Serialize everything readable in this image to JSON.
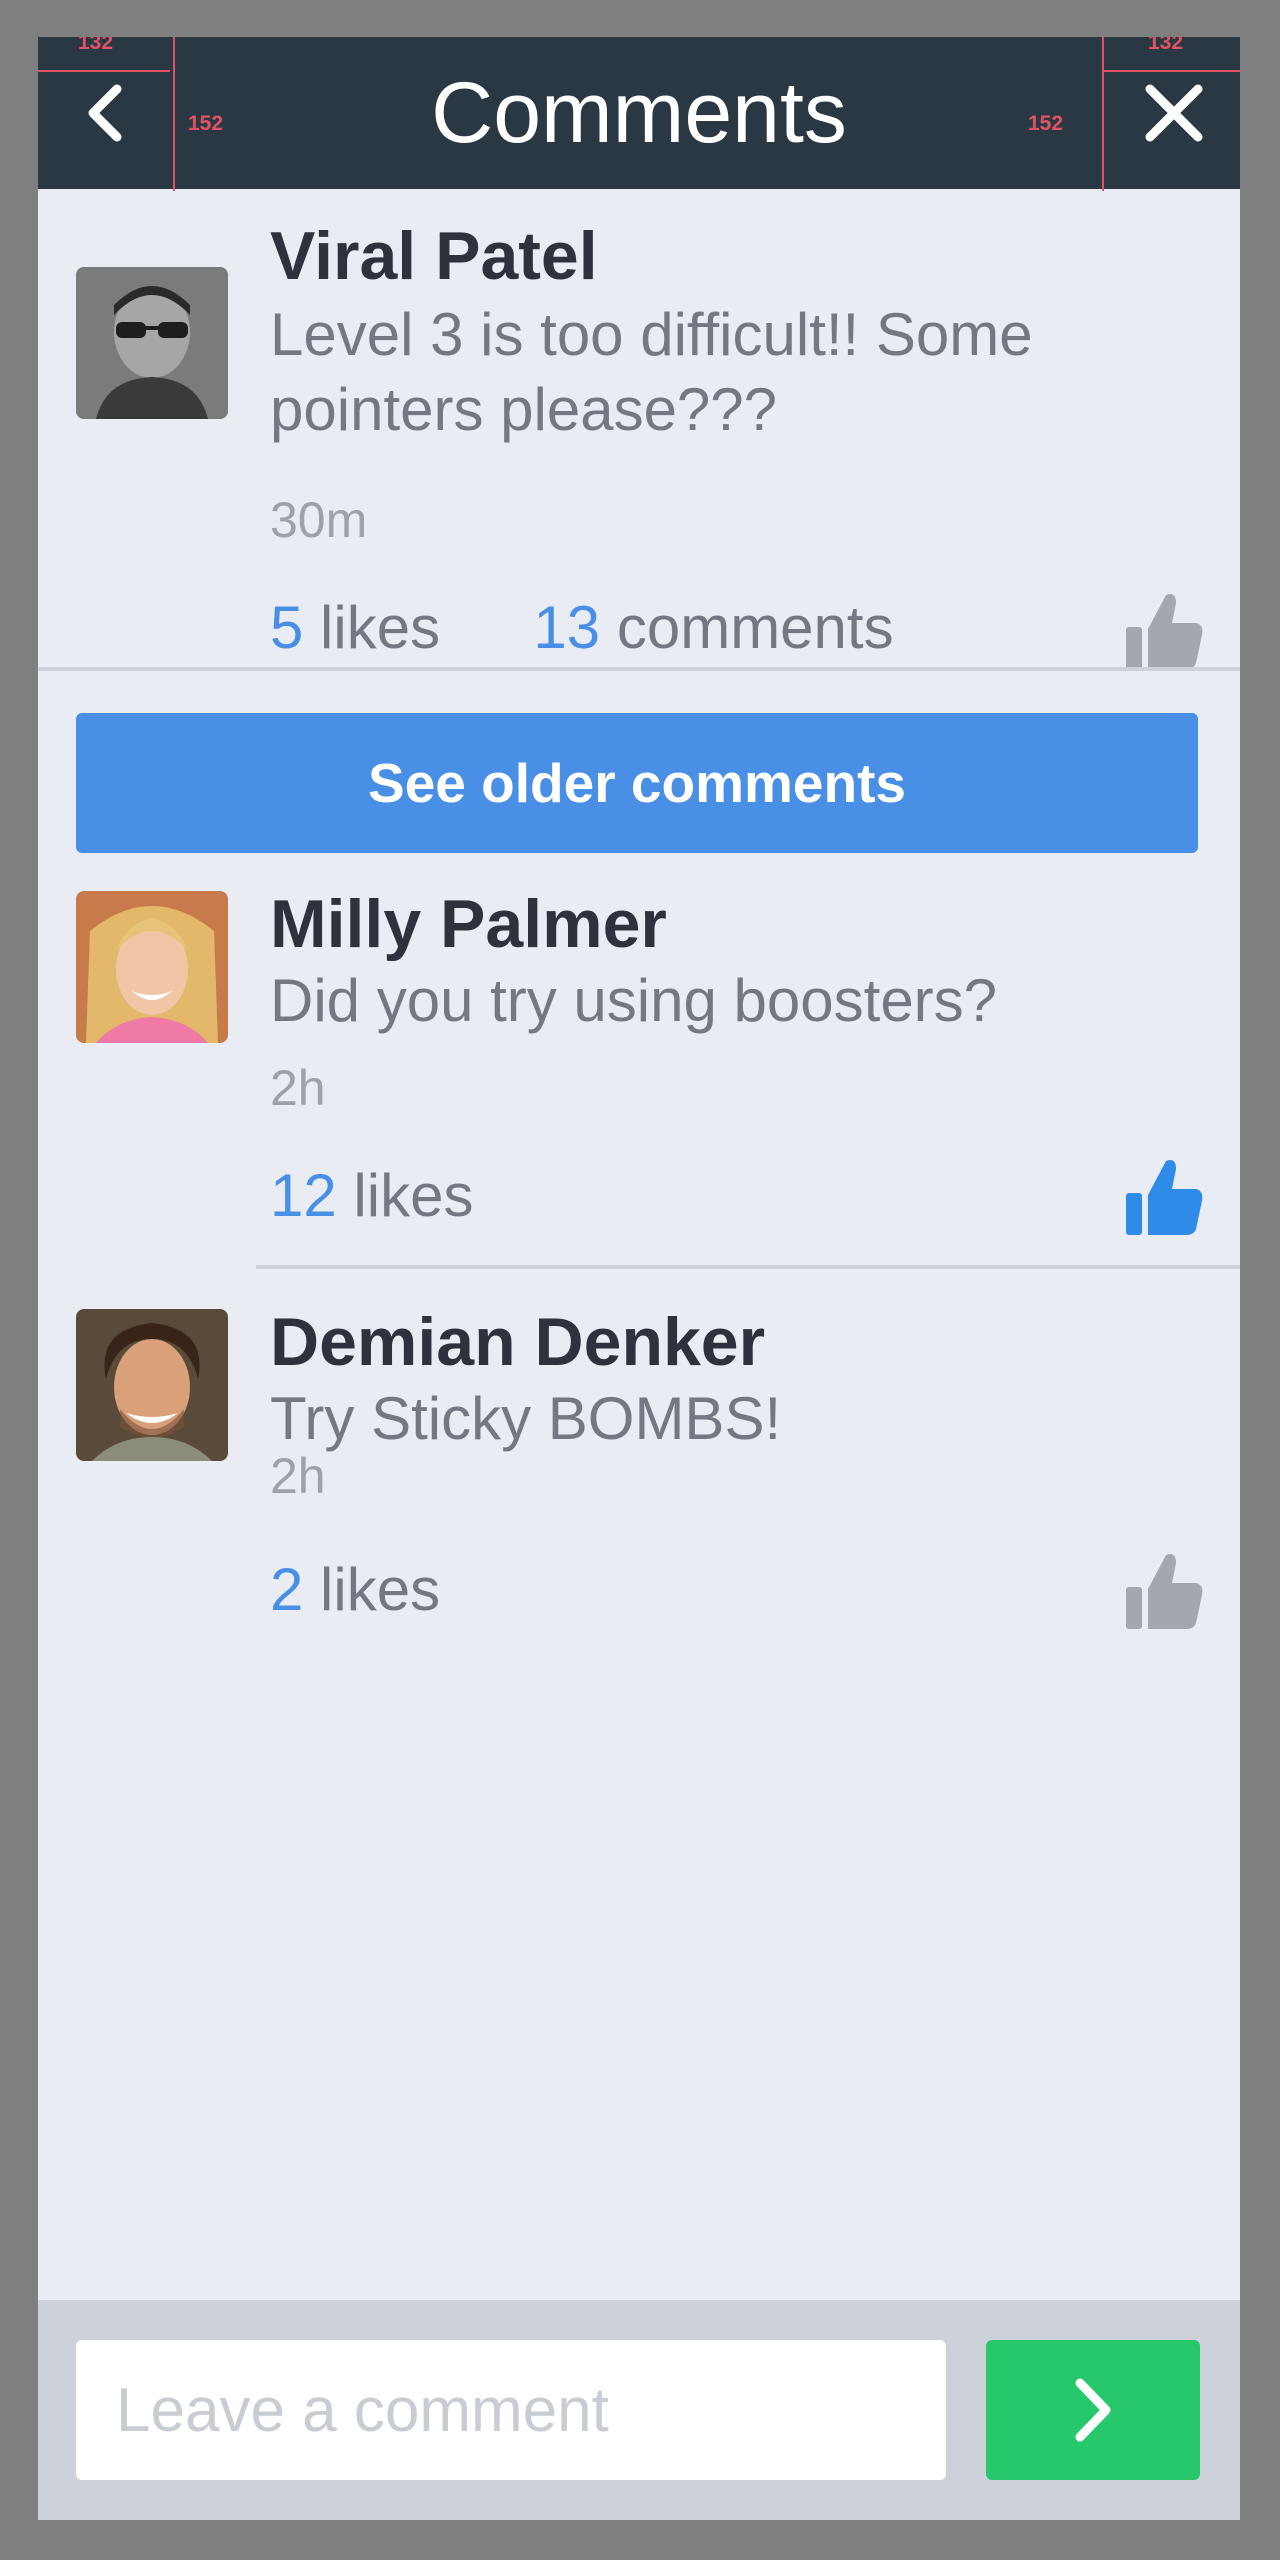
{
  "header": {
    "title": "Comments",
    "back_icon": "chevron-left-icon",
    "close_icon": "close-icon",
    "spec_labels": {
      "top_left": "132",
      "left": "152",
      "right": "152",
      "top_right": "132"
    },
    "background": "#2a3843"
  },
  "original_post": {
    "author": "Viral Patel",
    "text": "Level 3 is too difficult!! Some pointers please???",
    "time": "30m",
    "likes_count": "5",
    "likes_label": "likes",
    "comments_count": "13",
    "comments_label": "comments",
    "liked": false
  },
  "older_button": {
    "label": "See older comments",
    "color": "#4a8fe6"
  },
  "comments": [
    {
      "author": "Milly Palmer",
      "text": "Did you try using boosters?",
      "time": "2h",
      "likes_count": "12",
      "likes_label": "likes",
      "liked": true
    },
    {
      "author": "Demian Denker",
      "text": "Try Sticky BOMBS!",
      "time": "2h",
      "likes_count": "2",
      "likes_label": "likes",
      "liked": false
    }
  ],
  "footer": {
    "placeholder": "Leave a comment",
    "send_icon": "chevron-right-icon",
    "send_color": "#26c86b"
  },
  "colors": {
    "accent": "#4a8fe6",
    "like_inactive": "#a3a8b0",
    "like_active": "#2f8be8",
    "spec_marker": "#e05264"
  }
}
